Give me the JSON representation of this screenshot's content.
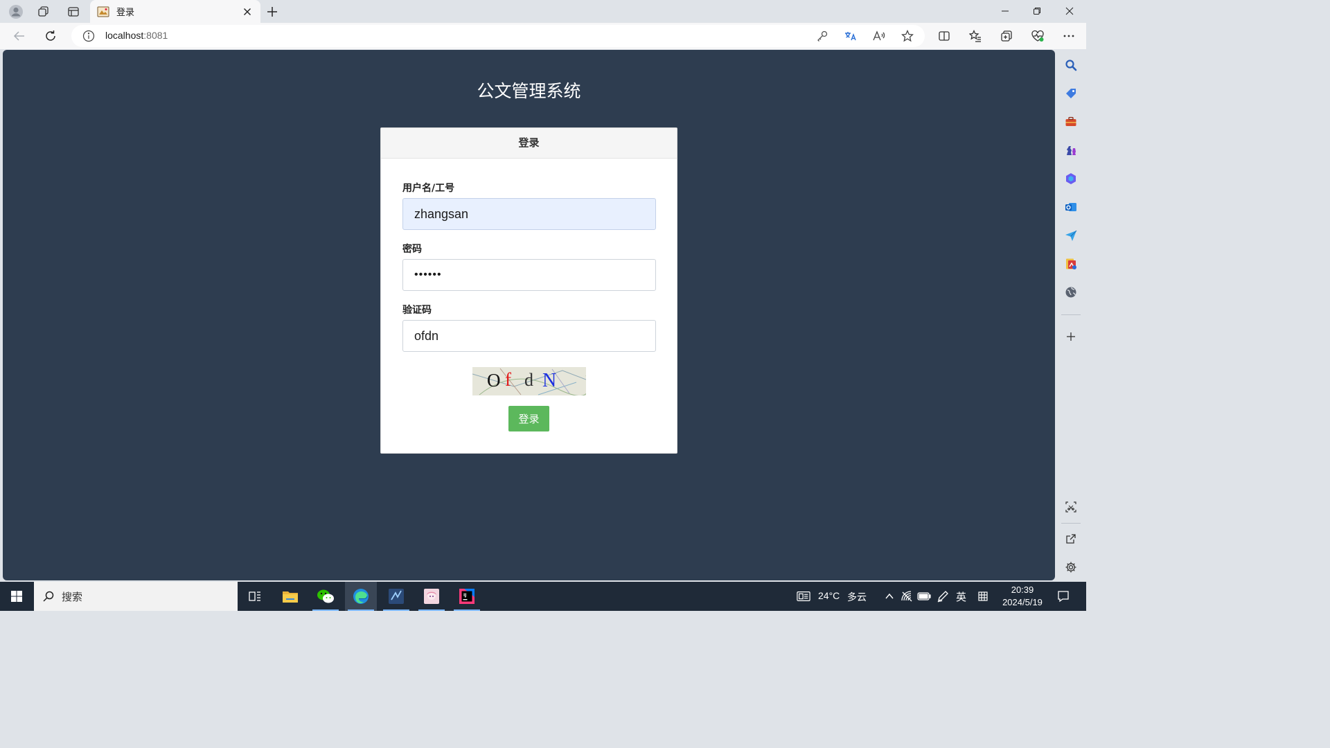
{
  "browser": {
    "tab": {
      "title": "登录"
    },
    "address": {
      "host": "localhost",
      "port": ":8081"
    }
  },
  "page": {
    "system_title": "公文管理系统",
    "login_card": {
      "header": "登录",
      "username": {
        "label": "用户名/工号",
        "value": "zhangsan"
      },
      "password": {
        "label": "密码",
        "value": "••••••"
      },
      "captcha": {
        "label": "验证码",
        "value": "ofdn",
        "image_text": [
          "O",
          "f",
          "d",
          "N"
        ]
      },
      "submit_label": "登录"
    }
  },
  "taskbar": {
    "search_label": "搜索",
    "weather": {
      "temp": "24°C",
      "condition": "多云"
    },
    "ime": "英",
    "clock": {
      "time": "20:39",
      "date": "2024/5/19"
    }
  },
  "colors": {
    "page_background": "#2e3d50",
    "login_button": "#5cb85c",
    "autofill_input": "#e8f0fe"
  }
}
